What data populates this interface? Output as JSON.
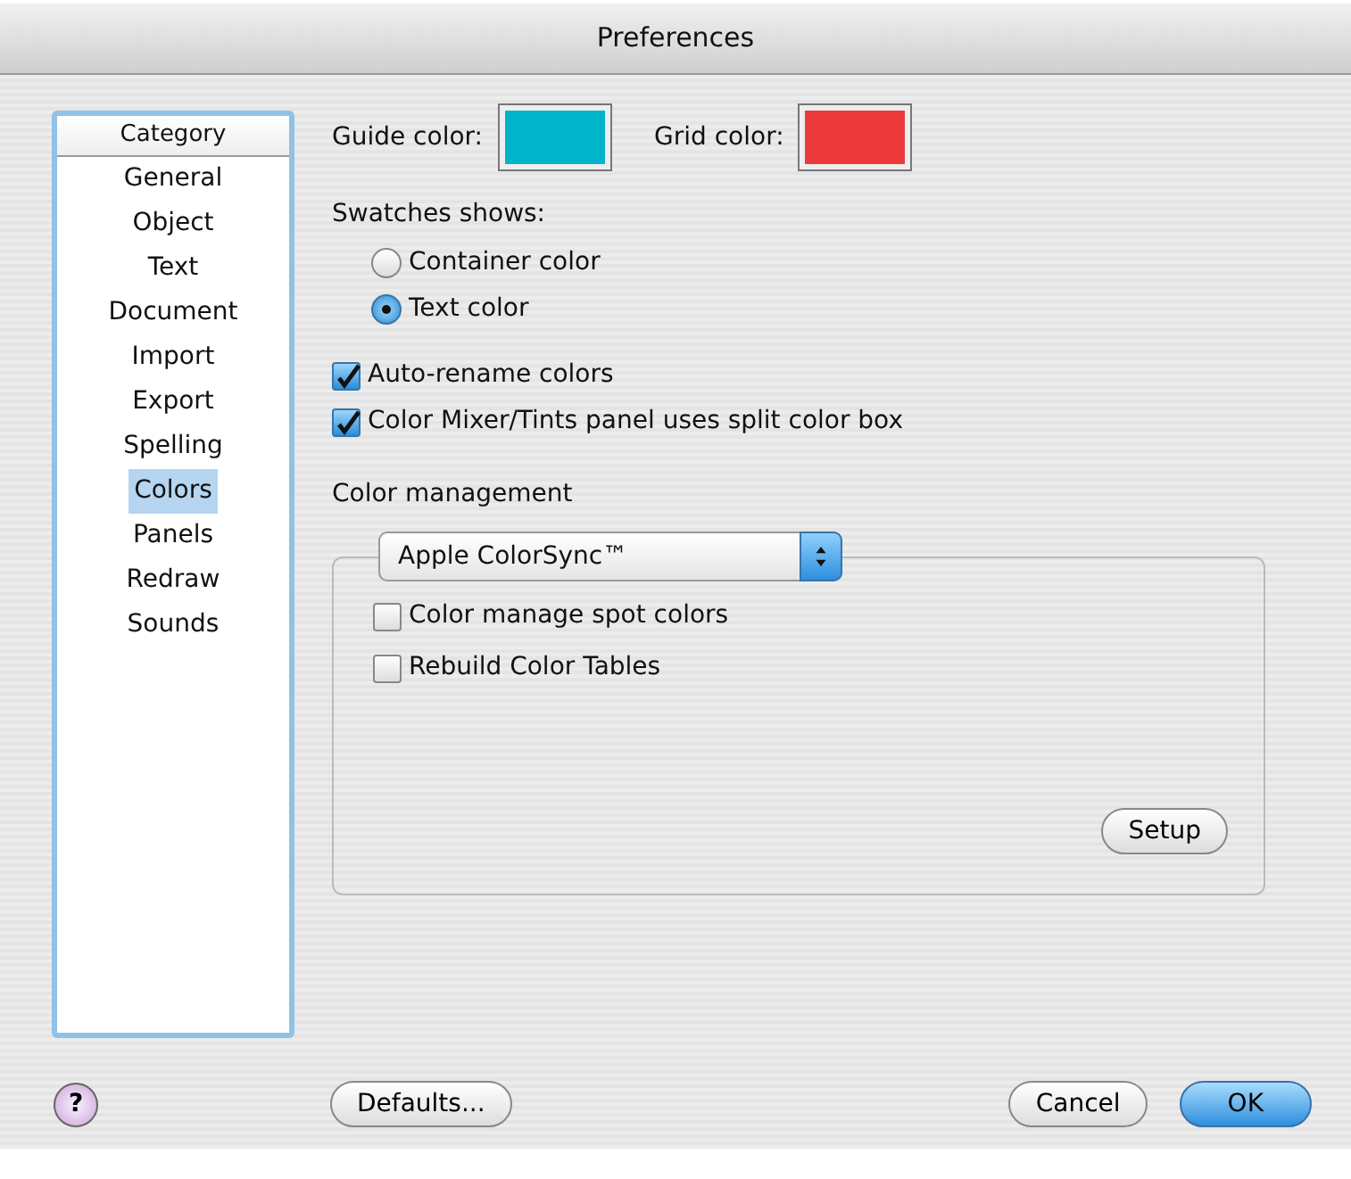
{
  "window": {
    "title": "Preferences"
  },
  "category_list": {
    "header": "Category",
    "items": [
      {
        "label": "General",
        "selected": false
      },
      {
        "label": "Object",
        "selected": false
      },
      {
        "label": "Text",
        "selected": false
      },
      {
        "label": "Document",
        "selected": false
      },
      {
        "label": "Import",
        "selected": false
      },
      {
        "label": "Export",
        "selected": false
      },
      {
        "label": "Spelling",
        "selected": false
      },
      {
        "label": "Colors",
        "selected": true
      },
      {
        "label": "Panels",
        "selected": false
      },
      {
        "label": "Redraw",
        "selected": false
      },
      {
        "label": "Sounds",
        "selected": false
      }
    ]
  },
  "color_wells": [
    {
      "label": "Guide color:",
      "color": "#00b4cc"
    },
    {
      "label": "Grid color:",
      "color": "#ec3a3c"
    }
  ],
  "swatches_shows": {
    "label": "Swatches shows:",
    "options": [
      {
        "label": "Container color",
        "selected": false
      },
      {
        "label": "Text color",
        "selected": true
      }
    ]
  },
  "options": [
    {
      "label": "Auto-rename colors",
      "checked": true
    },
    {
      "label": "Color Mixer/Tints panel uses split color box",
      "checked": true
    }
  ],
  "color_management": {
    "label": "Color management",
    "popup": "Apple ColorSync™",
    "options": [
      {
        "label": "Color manage spot colors",
        "checked": false
      },
      {
        "label": "Rebuild Color Tables",
        "checked": false
      }
    ],
    "setup_button": "Setup"
  },
  "footer": {
    "help_button": "?",
    "defaults_button": "Defaults...",
    "cancel_button": "Cancel",
    "ok_button": "OK"
  }
}
